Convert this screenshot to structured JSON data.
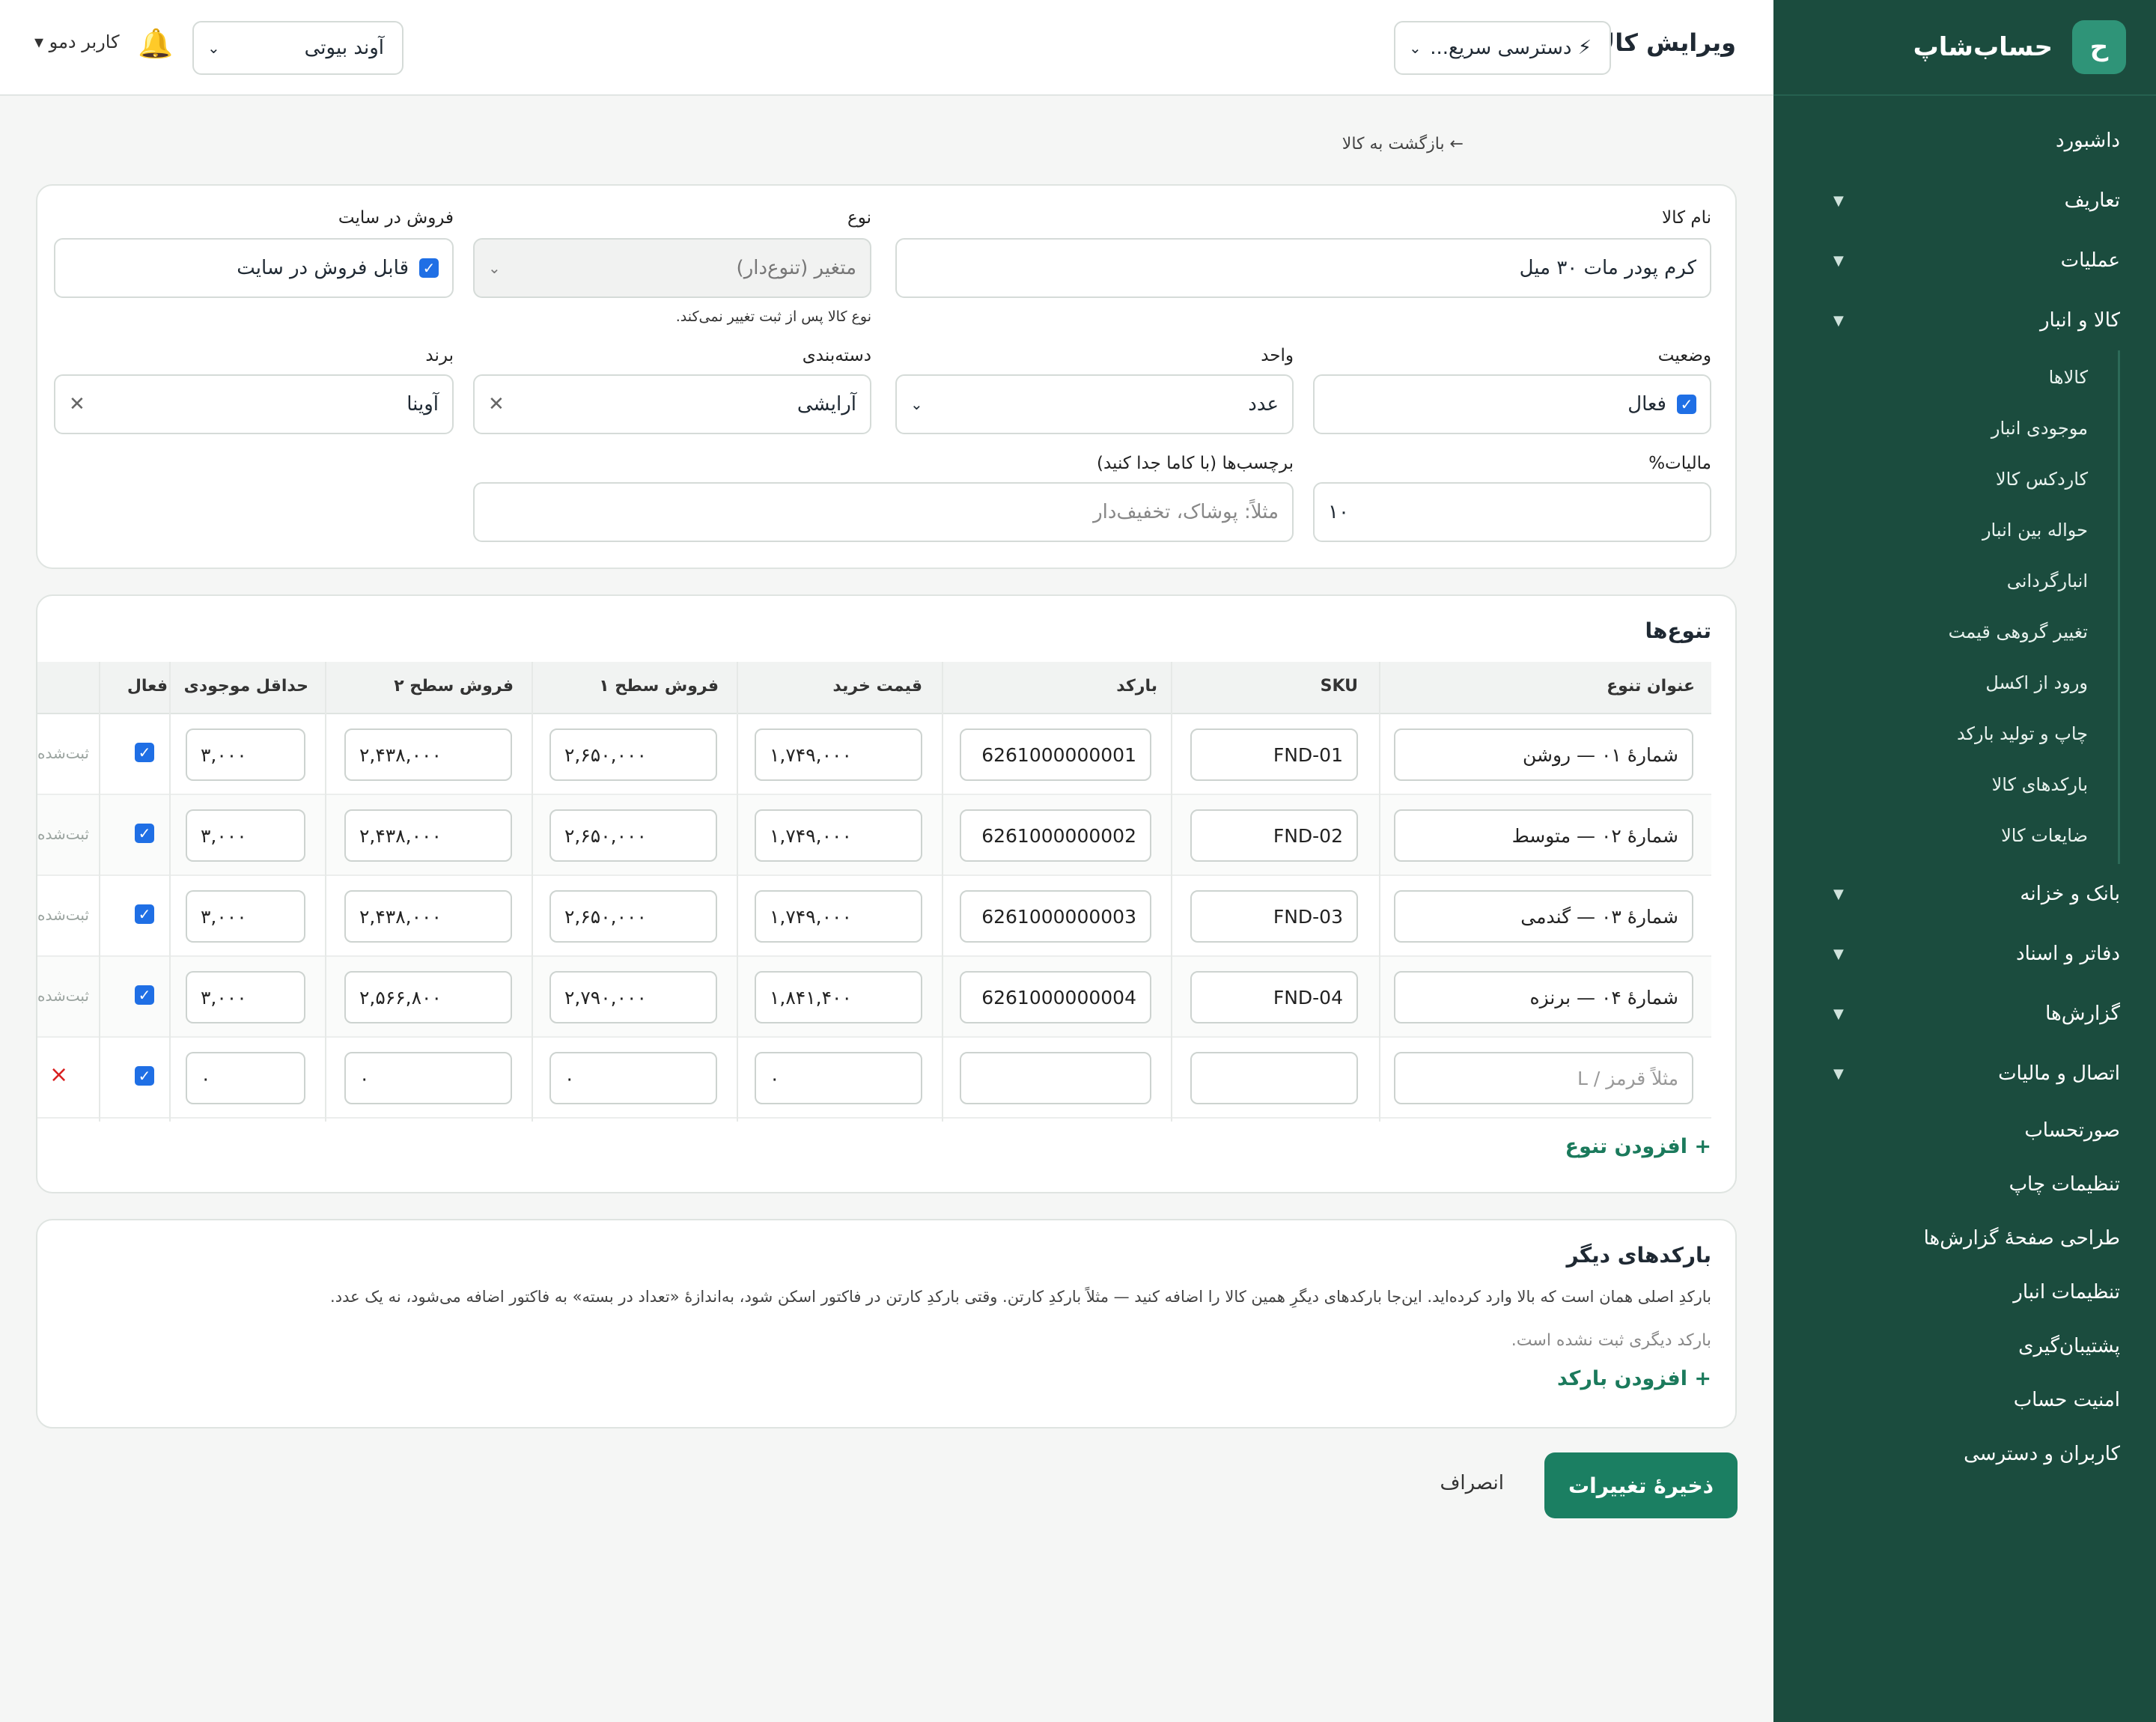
{
  "sidebar": {
    "logo_letter": "ح",
    "brand": "حساب‌شاپ",
    "items_top": [
      {
        "label": "داشبورد",
        "chevron": ""
      },
      {
        "label": "تعاریف",
        "chevron": "▼"
      },
      {
        "label": "عملیات",
        "chevron": "▼"
      },
      {
        "label": "کالا و انبار",
        "chevron": "▼"
      }
    ],
    "sub_items": [
      "کالاها",
      "موجودی انبار",
      "کاردکس کالا",
      "حواله بین انبار",
      "انبارگردانی",
      "تغییر گروهی قیمت",
      "ورود از اکسل",
      "چاپ و تولید بارکد",
      "بارکدهای کالا",
      "ضایعات کالا"
    ],
    "items_mid": [
      {
        "label": "بانک و خزانه",
        "chevron": "▼"
      },
      {
        "label": "دفاتر و اسناد",
        "chevron": "▼"
      },
      {
        "label": "گزارش‌ها",
        "chevron": "▼"
      },
      {
        "label": "اتصال و مالیات",
        "chevron": "▼"
      }
    ],
    "items_bottom": [
      "صورتحساب",
      "تنظیمات چاپ",
      "طراحی صفحهٔ گزارش‌ها",
      "تنظیمات انبار",
      "پشتیبان‌گیری",
      "امنیت حساب",
      "کاربران و دسترسی"
    ]
  },
  "topbar": {
    "title": "ویرایش کالا",
    "quick_access": "⚡ دسترسی سریع...",
    "store": "آوند بیوتی",
    "user": "کاربر دمو ▾"
  },
  "back_link": "← بازگشت به کالا",
  "form": {
    "name_label": "نام کالا",
    "name_value": "کرم پودر مات ۳۰ میل",
    "type_label": "نوع",
    "type_value": "متغیر (تنوع‌دار)",
    "type_hint": "نوع کالا پس از ثبت تغییر نمی‌کند.",
    "online_label": "فروش در سایت",
    "online_value": "قابل فروش در سایت",
    "status_label": "وضعیت",
    "status_value": "فعال",
    "unit_label": "واحد",
    "unit_value": "عدد",
    "category_label": "دسته‌بندی",
    "category_value": "آرایشی",
    "brand_label": "برند",
    "brand_value": "آوینا",
    "tax_label": "مالیات%",
    "tax_value": "۱۰",
    "tags_label": "برچسب‌ها (با کاما جدا کنید)",
    "tags_placeholder": "مثلاً: پوشاک، تخفیف‌دار"
  },
  "variants": {
    "title": "تنوع‌ها",
    "headers": [
      "عنوان تنوع",
      "SKU",
      "بارکد",
      "قیمت خرید",
      "فروش سطح ۱",
      "فروش سطح ۲",
      "حداقل موجودی",
      "فعال"
    ],
    "rows": [
      {
        "title": "شمارهٔ ۰۱ — روشن",
        "sku": "FND-01",
        "barcode": "6261000000001",
        "buy": "۱,۷۴۹,۰۰۰",
        "sell1": "۲,۶۵۰,۰۰۰",
        "sell2": "۲,۴۳۸,۰۰۰",
        "min": "۳,۰۰۰",
        "status": "ثبت‌شده"
      },
      {
        "title": "شمارهٔ ۰۲ — متوسط",
        "sku": "FND-02",
        "barcode": "6261000000002",
        "buy": "۱,۷۴۹,۰۰۰",
        "sell1": "۲,۶۵۰,۰۰۰",
        "sell2": "۲,۴۳۸,۰۰۰",
        "min": "۳,۰۰۰",
        "status": "ثبت‌شده"
      },
      {
        "title": "شمارهٔ ۰۳ — گندمی",
        "sku": "FND-03",
        "barcode": "6261000000003",
        "buy": "۱,۷۴۹,۰۰۰",
        "sell1": "۲,۶۵۰,۰۰۰",
        "sell2": "۲,۴۳۸,۰۰۰",
        "min": "۳,۰۰۰",
        "status": "ثبت‌شده"
      },
      {
        "title": "شمارهٔ ۰۴ — برنزه",
        "sku": "FND-04",
        "barcode": "6261000000004",
        "buy": "۱,۸۴۱,۴۰۰",
        "sell1": "۲,۷۹۰,۰۰۰",
        "sell2": "۲,۵۶۶,۸۰۰",
        "min": "۳,۰۰۰",
        "status": "ثبت‌شده"
      }
    ],
    "new_row": {
      "title_placeholder": "مثلاً قرمز / L",
      "buy": "۰",
      "sell1": "۰",
      "sell2": "۰",
      "min": "۰",
      "delete": "×"
    },
    "add": "+ افزودن تنوع"
  },
  "barcodes": {
    "title": "بارکدهای دیگر",
    "description": "بارکدِ اصلی همان است که بالا وارد کرده‌اید. این‌جا بارکدهای دیگرِ همین کالا را اضافه کنید — مثلاً بارکدِ کارتن. وقتی بارکدِ کارتن در فاکتور اسکن شود، به‌اندازهٔ «تعداد در بسته» به فاکتور اضافه می‌شود، نه یک عدد.",
    "empty": "بارکد دیگری ثبت نشده است.",
    "add": "+ افزودن بارکد"
  },
  "actions": {
    "save": "ذخیرهٔ تغییرات",
    "cancel": "انصراف"
  },
  "colors": {
    "sidebar": "#1b4c3e",
    "accent": "#1b7f62",
    "checkbox": "#1f6fe5",
    "delete": "#d92020"
  }
}
